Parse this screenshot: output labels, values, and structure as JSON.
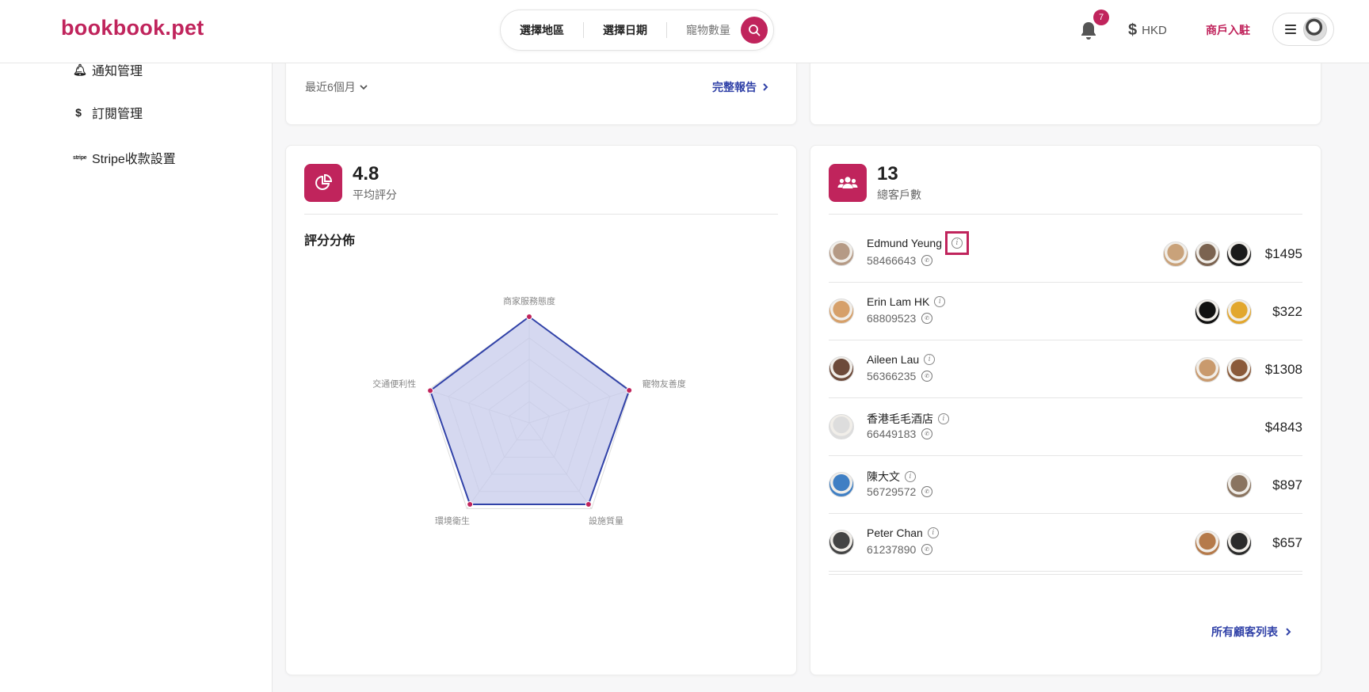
{
  "header": {
    "logo": "bookbook.pet",
    "search": {
      "region": "選擇地區",
      "date": "選擇日期",
      "pets": "寵物數量"
    },
    "notifications_count": "7",
    "currency": "HKD",
    "merchant_link": "商戶入駐"
  },
  "sidebar": {
    "items": [
      {
        "label": "通知管理",
        "icon": "bell-icon"
      },
      {
        "label": "訂閱管理",
        "icon": "dollar-icon"
      },
      {
        "label": "Stripe收款設置",
        "icon": "stripe-icon",
        "icon_text": "stripe"
      }
    ]
  },
  "top_card": {
    "period": "最近6個月",
    "full_report": "完整報告"
  },
  "rating_card": {
    "value": "4.8",
    "label": "平均評分",
    "section_title": "評分分佈"
  },
  "chart_data": {
    "type": "radar",
    "categories": [
      "商家服務態度",
      "寵物友善度",
      "設施質量",
      "環境衛生",
      "交通便利性"
    ],
    "values": [
      5,
      4.95,
      4.75,
      4.75,
      4.9
    ],
    "rmax": 5,
    "grid_levels": 5,
    "colors": {
      "line": "#3142a8",
      "fill": "#c7cbeb",
      "point": "#c0245c"
    }
  },
  "customers_card": {
    "value": "13",
    "label": "總客戶數",
    "customers": [
      {
        "name": "Edmund Yeung",
        "phone": "58466643",
        "amount": "$1495",
        "pets": [
          "#c9a27a",
          "#7b6350",
          "#1a1a1a"
        ],
        "avatar": "#b59a85",
        "highlight": true
      },
      {
        "name": "Erin Lam HK",
        "phone": "68809523",
        "amount": "$322",
        "pets": [
          "#111111",
          "#e2a72e"
        ],
        "avatar": "#d6a06a",
        "highlight": false
      },
      {
        "name": "Aileen Lau",
        "phone": "56366235",
        "amount": "$1308",
        "pets": [
          "#c99a6d",
          "#8a5a3a"
        ],
        "avatar": "#6d4a3a",
        "highlight": false
      },
      {
        "name": "香港毛毛酒店",
        "phone": "66449183",
        "amount": "$4843",
        "pets": [],
        "avatar": "#dddddd",
        "highlight": false
      },
      {
        "name": "陳大文",
        "phone": "56729572",
        "amount": "$897",
        "pets": [
          "#8a7460"
        ],
        "avatar": "#3f7fc4",
        "highlight": false
      },
      {
        "name": "Peter Chan",
        "phone": "61237890",
        "amount": "$657",
        "pets": [
          "#b57a4a",
          "#2b2b2b"
        ],
        "avatar": "#444444",
        "highlight": false
      }
    ],
    "all_link": "所有顧客列表"
  },
  "colors": {
    "brand": "#c0245c",
    "link": "#3142a8"
  }
}
